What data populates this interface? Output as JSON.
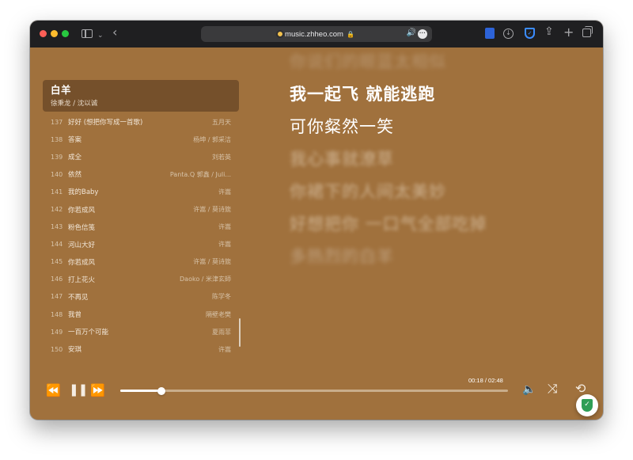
{
  "browser": {
    "url": "music.zhheo.com"
  },
  "now_playing": {
    "title": "白羊",
    "artist": "徐秉龙 / 沈以诚"
  },
  "songs": [
    {
      "num": "137",
      "title": "好好 (想把你写成一首歌)",
      "artist": "五月天"
    },
    {
      "num": "138",
      "title": "答案",
      "artist": "杨坤 / 郭采洁"
    },
    {
      "num": "139",
      "title": "成全",
      "artist": "刘若英"
    },
    {
      "num": "140",
      "title": "依然",
      "artist": "Panta.Q 郭鑫 / Juli..."
    },
    {
      "num": "141",
      "title": "我的Baby",
      "artist": "许嵩"
    },
    {
      "num": "142",
      "title": "你若成风",
      "artist": "许嵩 / 莫诗旎"
    },
    {
      "num": "143",
      "title": "粉色信笺",
      "artist": "许嵩"
    },
    {
      "num": "144",
      "title": "河山大好",
      "artist": "许嵩"
    },
    {
      "num": "145",
      "title": "你若成风",
      "artist": "许嵩 / 莫诗旎"
    },
    {
      "num": "146",
      "title": "打上花火",
      "artist": "Daoko / 米津玄師"
    },
    {
      "num": "147",
      "title": "不再见",
      "artist": "陈学冬"
    },
    {
      "num": "148",
      "title": "我曾",
      "artist": "隔壁老樊"
    },
    {
      "num": "149",
      "title": "一百万个可能",
      "artist": "夏雨菲"
    },
    {
      "num": "150",
      "title": "安琪",
      "artist": "许嵩"
    }
  ],
  "lyrics": {
    "previous": "你说们的眼蓝太相似",
    "lines": [
      {
        "text": "我一起飞 就能逃跑",
        "state": "active"
      },
      {
        "text": "可你粲然一笑",
        "state": "current"
      },
      {
        "text": "我心事就潦草",
        "state": "blur"
      },
      {
        "text": "你裙下的人间太美妙",
        "state": "blur"
      },
      {
        "text": "好想把你 一口气全部吃掉",
        "state": "blur"
      },
      {
        "text": "多热烈的白羊",
        "state": "faint"
      }
    ]
  },
  "player": {
    "time_readout": "00:18 / 02:48",
    "progress": 0.107,
    "icons": {
      "prev": "⏪",
      "pause": "❚❚",
      "next": "⏩",
      "volume": "🔈",
      "shuffle": "⤨",
      "repeat": "⟲"
    }
  },
  "colors": {
    "background": "#a0713d",
    "card": "#75502b",
    "titlebar": "#1f1f21",
    "security_badge": "#2e9e56"
  }
}
